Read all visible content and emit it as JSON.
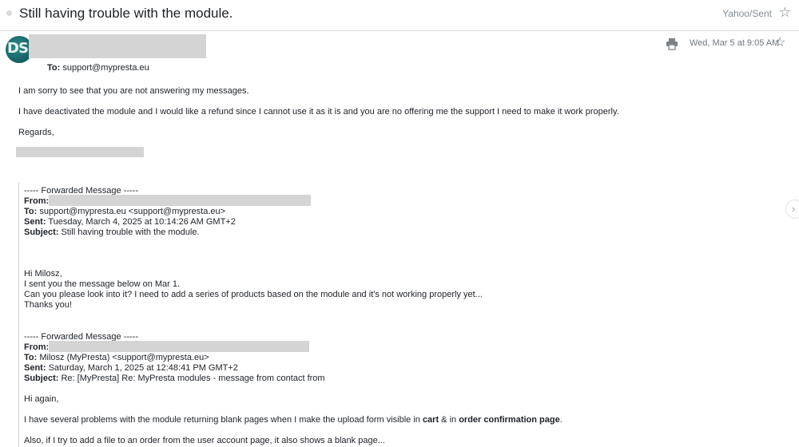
{
  "header": {
    "subject": "Still having trouble with the module.",
    "folder": "Yahoo/Sent",
    "star_icon": "☆"
  },
  "message": {
    "avatar_initials": "DS",
    "to_label": "To:",
    "to_value": "support@mypresta.eu",
    "date": "Wed, Mar 5 at 9:05 AM",
    "star_icon": "☆",
    "print_icon": "printer-icon",
    "body": {
      "line1": "I am sorry to see that you are not answering my messages.",
      "line2": "I have deactivated the module and I would like a refund since I cannot use it as it is and you are no offering me the support I need to make it work properly.",
      "line3": "Regards,"
    }
  },
  "forward1": {
    "header": "----- Forwarded Message -----",
    "from_label": "From:",
    "to_label": "To:",
    "to_value": "support@mypresta.eu <support@mypresta.eu>",
    "sent_label": "Sent:",
    "sent_value": "Tuesday, March 4, 2025 at 10:14:26 AM GMT+2",
    "subject_label": "Subject:",
    "subject_value": "Still having trouble with the module.",
    "body": [
      "Hi Milosz,",
      "I sent you the message below on Mar 1.",
      "Can you please look into it? I need to add a series of products based on the module and it's not working properly yet...",
      "Thanks you!"
    ]
  },
  "forward2": {
    "header": "----- Forwarded Message -----",
    "from_label": "From:",
    "to_label": "To:",
    "to_value": "Milosz (MyPresta) <support@mypresta.eu>",
    "sent_label": "Sent:",
    "sent_value": "Saturday, March 1, 2025 at 12:48:41 PM GMT+2",
    "subject_label": "Subject:",
    "subject_value": "Re: [MyPresta] Re: MyPresta modules - message from contact from",
    "greeting": "Hi again,",
    "p1_pre": "I have several problems with the module returning blank pages when I make the upload form visible  in ",
    "p1_cart": "cart",
    "p1_mid": " & in ",
    "p1_order": "order confirmation page",
    "p1_end": ".",
    "p2": "Also, if I try to add a file to an order from the user account page, it also shows a blank page..."
  },
  "nav": {
    "next_icon": "›"
  }
}
